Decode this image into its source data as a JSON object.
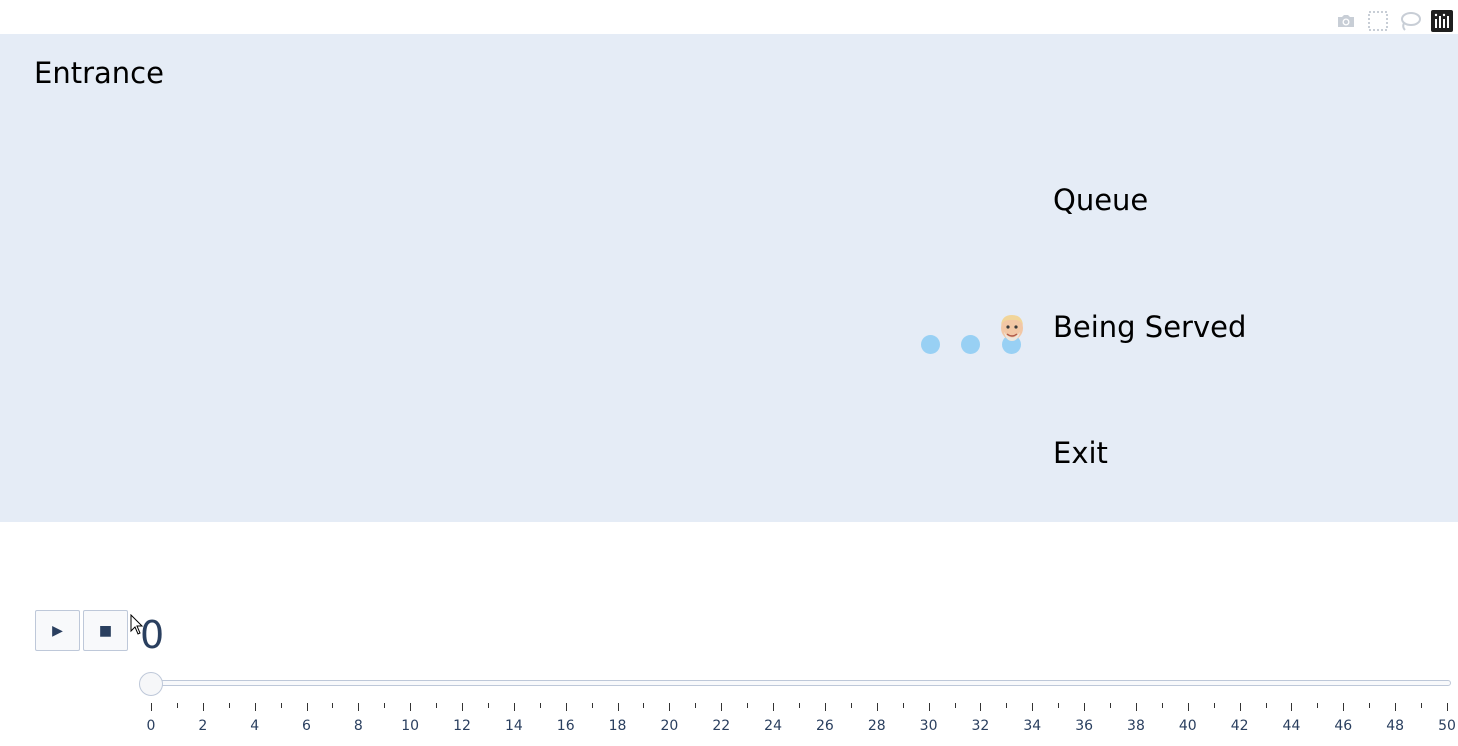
{
  "modebar": {
    "icons": [
      "camera-icon",
      "box-select-icon",
      "lasso-select-icon",
      "plotly-logo-icon"
    ]
  },
  "plot": {
    "background": "#e5ecf6",
    "annotations": {
      "entrance": "Entrance",
      "queue": "Queue",
      "being_served": "Being Served",
      "exit": "Exit"
    },
    "markers": {
      "color": "#8fcdf4",
      "count": 3,
      "emoji": "person-emoji-icon"
    }
  },
  "animation": {
    "play_icon": "▶",
    "stop_icon": "■",
    "current_frame": "0"
  },
  "slider": {
    "min": 0,
    "max": 50,
    "value": 0,
    "tick_labels": [
      "0",
      "2",
      "4",
      "6",
      "8",
      "10",
      "12",
      "14",
      "16",
      "18",
      "20",
      "22",
      "24",
      "26",
      "28",
      "30",
      "32",
      "34",
      "36",
      "38",
      "40",
      "42",
      "44",
      "46",
      "48",
      "50"
    ]
  }
}
